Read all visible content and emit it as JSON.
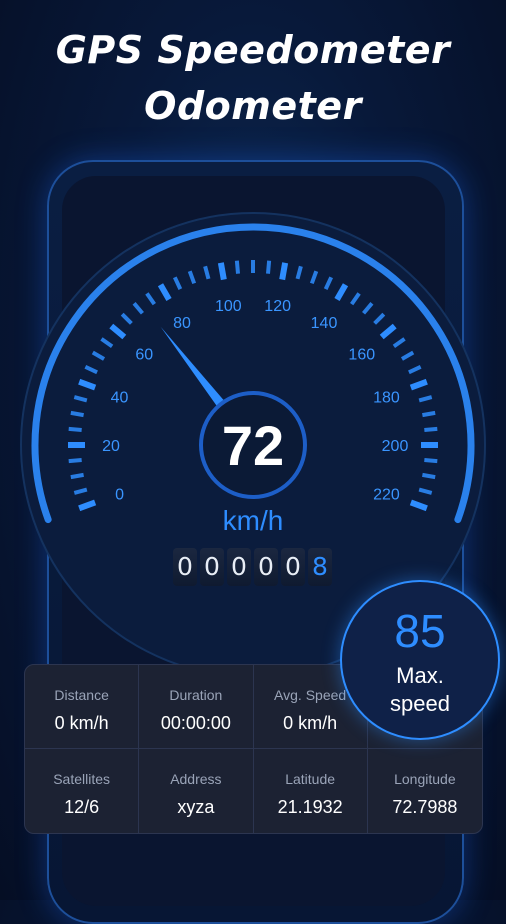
{
  "headline": {
    "line1": "GPS Speedometer",
    "line2": "Odometer"
  },
  "gauge": {
    "current_speed": "72",
    "unit": "km/h",
    "min": 0,
    "max": 220,
    "needle_value": 72,
    "tick_labels": [
      "0",
      "20",
      "40",
      "60",
      "80",
      "100",
      "120",
      "140",
      "160",
      "180",
      "200",
      "220"
    ],
    "accent_color": "#2e8dff"
  },
  "odometer": {
    "digits": [
      "0",
      "0",
      "0",
      "0",
      "0",
      "8"
    ]
  },
  "max_speed": {
    "value": "85",
    "label": "Max.\nspeed"
  },
  "stats": [
    {
      "label": "Distance",
      "value": "0 km/h"
    },
    {
      "label": "Duration",
      "value": "00:00:00"
    },
    {
      "label": "Avg. Speed",
      "value": "0 km/h"
    },
    {
      "label": "",
      "value": ""
    },
    {
      "label": "Satellites",
      "value": "12/6"
    },
    {
      "label": "Address",
      "value": "xyza"
    },
    {
      "label": "Latitude",
      "value": "21.1932"
    },
    {
      "label": "Longitude",
      "value": "72.7988"
    }
  ]
}
